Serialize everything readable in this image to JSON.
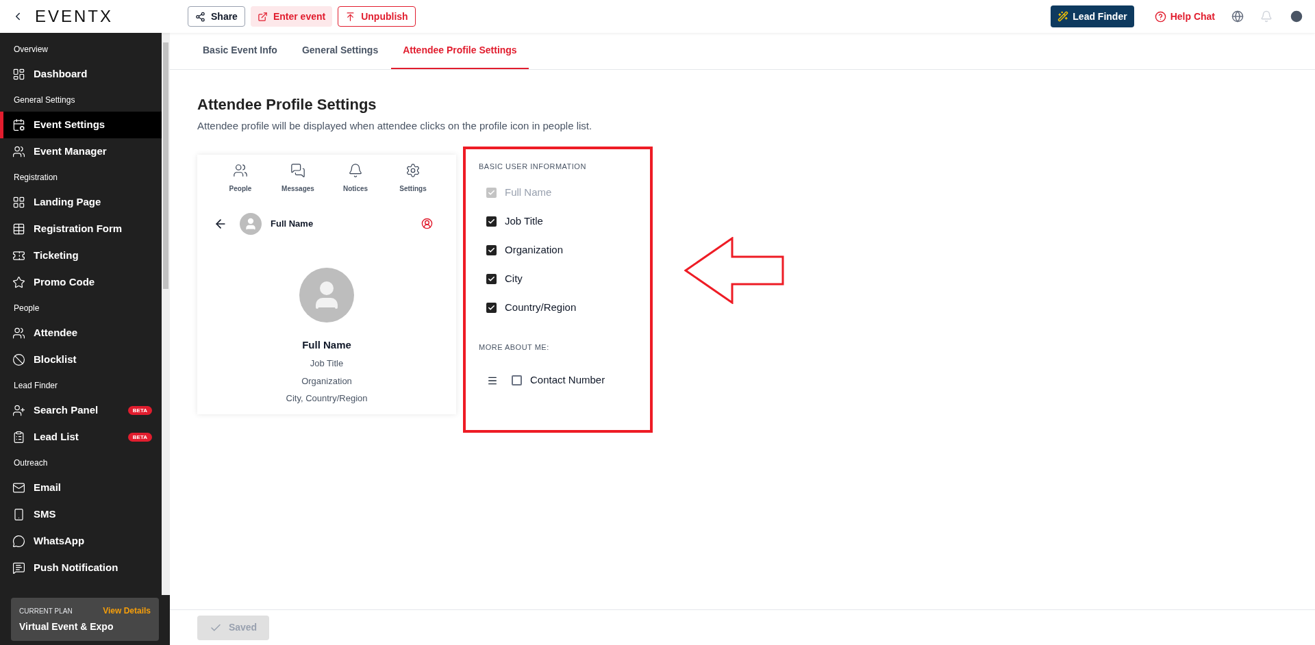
{
  "header": {
    "logo": "EVENTX",
    "actions": [
      {
        "label": "Share",
        "kind": "outline"
      },
      {
        "label": "Enter event",
        "kind": "tinted"
      },
      {
        "label": "Unpublish",
        "kind": "danger"
      }
    ],
    "lead_finder": "Lead Finder",
    "help": "Help Chat"
  },
  "sidebar": {
    "sections": [
      {
        "title": "Overview",
        "items": [
          {
            "label": "Dashboard",
            "selected": false
          }
        ]
      },
      {
        "title": "General Settings",
        "items": [
          {
            "label": "Event Settings",
            "selected": true
          },
          {
            "label": "Event Manager",
            "selected": false
          }
        ]
      },
      {
        "title": "Registration",
        "items": [
          {
            "label": "Landing Page",
            "selected": false
          },
          {
            "label": "Registration Form",
            "selected": false
          },
          {
            "label": "Ticketing",
            "selected": false
          },
          {
            "label": "Promo Code",
            "selected": false
          }
        ]
      },
      {
        "title": "People",
        "items": [
          {
            "label": "Attendee",
            "selected": false
          },
          {
            "label": "Blocklist",
            "selected": false
          }
        ]
      },
      {
        "title": "Lead Finder",
        "items": [
          {
            "label": "Search Panel",
            "selected": false,
            "badge": "BETA"
          },
          {
            "label": "Lead List",
            "selected": false,
            "badge": "BETA"
          }
        ]
      },
      {
        "title": "Outreach",
        "items": [
          {
            "label": "Email",
            "selected": false
          },
          {
            "label": "SMS",
            "selected": false
          },
          {
            "label": "WhatsApp",
            "selected": false
          },
          {
            "label": "Push Notification",
            "selected": false
          }
        ]
      }
    ],
    "plan": {
      "caption": "CURRENT PLAN",
      "link": "View Details",
      "name": "Virtual Event & Expo"
    }
  },
  "tabs": [
    {
      "label": "Basic Event Info",
      "selected": false
    },
    {
      "label": "General Settings",
      "selected": false
    },
    {
      "label": "Attendee Profile Settings",
      "selected": true
    }
  ],
  "page": {
    "title": "Attendee Profile Settings",
    "subtitle": "Attendee profile will be displayed when attendee clicks on the profile icon in people list."
  },
  "preview": {
    "nav": [
      "People",
      "Messages",
      "Notices",
      "Settings"
    ],
    "header_name": "Full Name",
    "name": "Full Name",
    "lines": [
      "Job Title",
      "Organization",
      "City, Country/Region"
    ]
  },
  "settings": {
    "basic_title": "BASIC USER INFORMATION",
    "basic": [
      {
        "label": "Full Name",
        "checked": true,
        "disabled": true
      },
      {
        "label": "Job Title",
        "checked": true,
        "disabled": false
      },
      {
        "label": "Organization",
        "checked": true,
        "disabled": false
      },
      {
        "label": "City",
        "checked": true,
        "disabled": false
      },
      {
        "label": "Country/Region",
        "checked": true,
        "disabled": false
      }
    ],
    "more_title": "MORE ABOUT ME:",
    "more": [
      {
        "label": "Contact Number",
        "checked": false,
        "disabled": false
      }
    ]
  },
  "footer": {
    "save": {
      "label": "Saved",
      "disabled": true
    }
  }
}
